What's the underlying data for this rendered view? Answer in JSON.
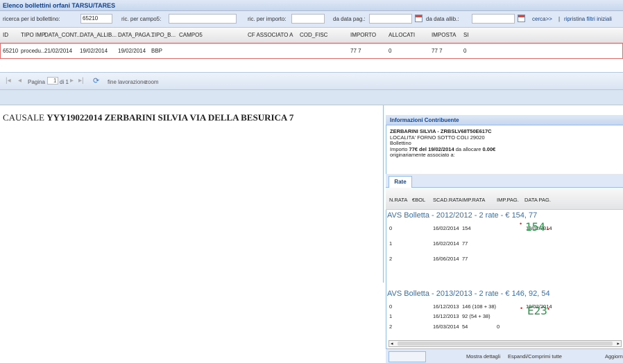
{
  "window": {
    "title": "Elenco bollettini orfani TARSU/TARES"
  },
  "filters": {
    "bollettino_label": "ricerca per id bollettino:",
    "bollettino_value": "65210",
    "campo_label": "ric. per campo5:",
    "campo_value": "",
    "importo_label": "ric. per importo:",
    "importo_value": "",
    "da_data_pag_label": "da data pag.:",
    "da_data_pag_value": "",
    "da_data_allib_label": "da data allib.:",
    "da_data_allib_value": "",
    "search_label": "cerca>>",
    "separator": "|",
    "reset_label": "ripristina filtri iniziali"
  },
  "grid": {
    "columns": [
      "ID",
      "TIPO IMP.",
      "DATA_CONT...",
      "DATA_ALLIB...",
      "DATA_PAGA...",
      "TIPO_B...",
      "CAMPO5",
      "CF ASSOCIATO A",
      "COD_FISC",
      "IMPORTO",
      "ALLOCATI",
      "IMPOSTA",
      "SI"
    ],
    "rows": [
      [
        "65210",
        "procedu...",
        "21/02/2014",
        "19/02/2014",
        "19/02/2014",
        "BBP",
        "",
        "",
        "",
        "77 7",
        "0",
        "77 7",
        "0"
      ]
    ]
  },
  "pager": {
    "page_label": "Pagina",
    "page_value": "1",
    "of_label": "di 1",
    "status": "fine lavorazione",
    "zoom": "zoom"
  },
  "causale": {
    "label": "CAUSALE",
    "value": "YYY19022014 ZERBARINI SILVIA VIA DELLA BESURICA 7"
  },
  "info": {
    "title": "Informazioni Contribuente",
    "name": "ZERBARINI SILVIA - ZRBSLV68T50E617C",
    "address": "LOCALITA' FORNO SOTTO COLI 29020",
    "type": "Bollettino",
    "importo_prefix": "Importo",
    "importo_amount": "77€",
    "importo_mid": "del",
    "importo_date": "19/02/2014",
    "importo_suffix": "da allocare",
    "allocare_amount": "0.00€",
    "orig": "originariamente associato a:"
  },
  "rate": {
    "tab_label": "Rate",
    "columns": [
      "N.RATA",
      "€BOL",
      "SCAD.RATA",
      "IMP.RATA",
      "IMP.PAG.",
      "DATA PAG."
    ],
    "group1": {
      "title": "AVS Bolletta - 2012/2012 - 2 rate - € 154, 77",
      "rows": [
        [
          "0",
          "",
          "16/02/2014",
          "154",
          "",
          "19/02/2014"
        ],
        [
          "1",
          "",
          "16/02/2014",
          "77",
          "",
          ""
        ],
        [
          "2",
          "",
          "16/06/2014",
          "77",
          "",
          ""
        ]
      ],
      "handwritten": "154"
    },
    "group2": {
      "title": "AVS Bolletta - 2013/2013 - 2 rate - € 146, 92, 54",
      "rows": [
        [
          "0",
          "",
          "16/12/2013",
          "146 (108 + 38)",
          "",
          "19/02/2014"
        ],
        [
          "1",
          "",
          "16/12/2013",
          "92 (54 + 38)",
          "",
          ""
        ],
        [
          "2",
          "",
          "16/03/2014",
          "54",
          "0",
          ""
        ]
      ],
      "handwritten": "E23"
    }
  },
  "buttons": {
    "details": "Mostra dettagli",
    "expand": "Espandi/Comprimi tutte",
    "refresh": "Aggiorna"
  },
  "colors": {
    "header_blue": "#15428b",
    "row_border": "#e06c6c",
    "handwritten_green": "#2a9a4a"
  }
}
